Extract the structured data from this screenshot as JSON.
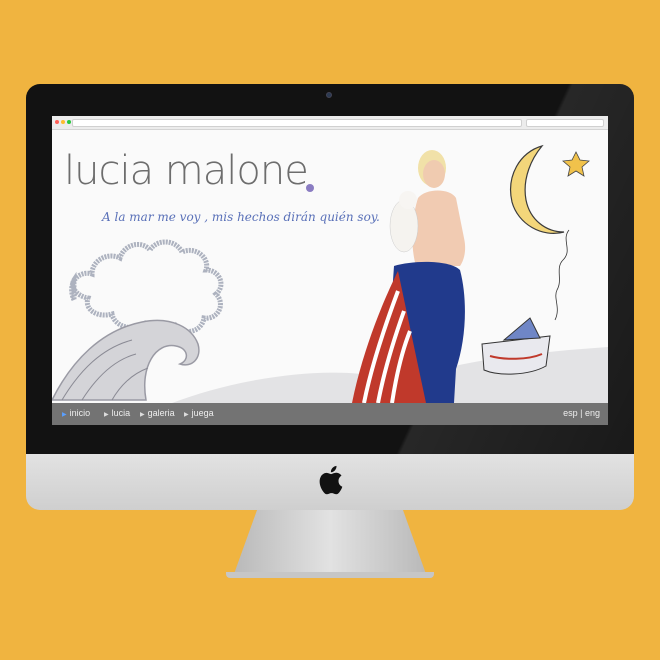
{
  "site": {
    "title": "lucia malone",
    "tagline": "A la mar me voy , mis hechos dirán quién soy."
  },
  "nav": {
    "items": [
      {
        "label": "inicio",
        "active": true
      },
      {
        "label": "lucia",
        "active": false
      },
      {
        "label": "galeria",
        "active": false
      },
      {
        "label": "juega",
        "active": false
      }
    ],
    "lang_esp": "esp",
    "lang_sep": "|",
    "lang_eng": "eng"
  },
  "colors": {
    "background": "#f0b440",
    "title": "#6d6d6d",
    "tagline": "#5970b8",
    "nav_bg": "#5a5a5a",
    "active_arrow": "#5aa0ff"
  },
  "icons": [
    "apple-logo",
    "moon",
    "star",
    "paper-boat",
    "wave",
    "cloud"
  ]
}
